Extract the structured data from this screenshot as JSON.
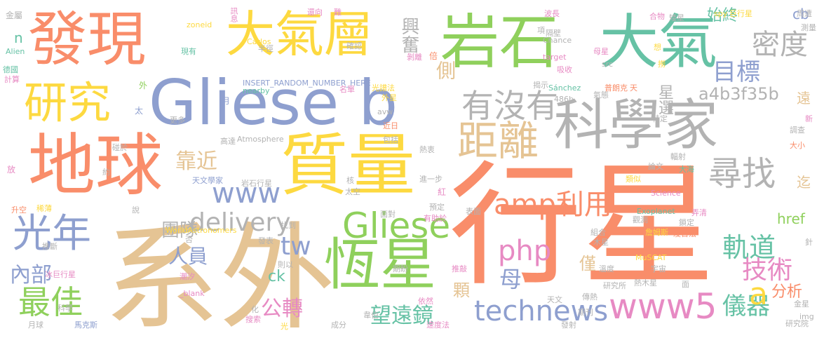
{
  "palette": {
    "orange": "#f98d6a",
    "blue": "#8e9fcf",
    "green": "#8fd05c",
    "yellow": "#fdd940",
    "gray": "#b3b3b3",
    "tan": "#e5c494",
    "teal": "#66c2a5",
    "pink": "#e78ac3"
  },
  "words": [
    {
      "text": "行星",
      "color": "orange"
    },
    {
      "text": "系外",
      "color": "tan"
    },
    {
      "text": "Gliese b",
      "color": "blue"
    },
    {
      "text": "科學家",
      "color": "gray"
    },
    {
      "text": "岩石",
      "color": "green"
    },
    {
      "text": "大氣",
      "color": "teal"
    },
    {
      "text": "發現",
      "color": "orange"
    },
    {
      "text": "大氣層",
      "color": "yellow"
    },
    {
      "text": "質量",
      "color": "yellow"
    },
    {
      "text": "地球",
      "color": "orange"
    },
    {
      "text": "恆星",
      "color": "green"
    },
    {
      "text": "研究",
      "color": "yellow"
    },
    {
      "text": "距離",
      "color": "tan"
    },
    {
      "text": "Gliese",
      "color": "green"
    },
    {
      "text": "www5",
      "color": "pink"
    },
    {
      "text": "光年",
      "color": "blue"
    },
    {
      "text": "technews",
      "color": "blue"
    },
    {
      "text": "尋找",
      "color": "gray"
    },
    {
      "text": "有沒有",
      "color": "gray"
    },
    {
      "text": "最佳",
      "color": "green"
    },
    {
      "text": "密度",
      "color": "gray"
    },
    {
      "text": "目標",
      "color": "blue"
    },
    {
      "text": "www",
      "color": "blue"
    },
    {
      "text": "delivery",
      "color": "gray"
    },
    {
      "text": "amp利用",
      "color": "orange"
    },
    {
      "text": "php",
      "color": "pink"
    },
    {
      "text": "靠近",
      "color": "tan"
    },
    {
      "text": "團隊",
      "color": "gray"
    },
    {
      "text": "軌道",
      "color": "teal"
    },
    {
      "text": "技術",
      "color": "pink"
    },
    {
      "text": "興奮",
      "color": "gray"
    },
    {
      "text": "始終",
      "color": "teal"
    },
    {
      "text": "a4b3f35b",
      "color": "gray"
    },
    {
      "text": "星選",
      "color": "gray"
    },
    {
      "text": "側",
      "color": "tan"
    },
    {
      "text": "tw",
      "color": "blue"
    },
    {
      "text": "人員",
      "color": "blue"
    },
    {
      "text": "內部",
      "color": "blue"
    },
    {
      "text": "公轉",
      "color": "pink"
    },
    {
      "text": "母",
      "color": "blue"
    },
    {
      "text": "望遠鏡",
      "color": "teal"
    },
    {
      "text": "儀器",
      "color": "teal"
    },
    {
      "text": "分析",
      "color": "orange"
    },
    {
      "text": "a",
      "color": "yellow"
    },
    {
      "text": "cb",
      "color": "blue"
    },
    {
      "text": "ck",
      "color": "teal"
    },
    {
      "text": "href",
      "color": "green"
    },
    {
      "text": "僅",
      "color": "tan"
    },
    {
      "text": "顆",
      "color": "tan"
    },
    {
      "text": "遠",
      "color": "tan"
    },
    {
      "text": "迄",
      "color": "tan"
    },
    {
      "text": "n",
      "color": "teal"
    },
    {
      "text": "金屬",
      "color": "gray"
    },
    {
      "text": "Alien",
      "color": "teal"
    },
    {
      "text": "德國",
      "color": "teal"
    },
    {
      "text": "計算",
      "color": "pink"
    },
    {
      "text": "訊息",
      "color": "pink"
    },
    {
      "text": "半徑",
      "color": "gray"
    },
    {
      "text": "zoneid",
      "color": "yellow"
    },
    {
      "text": "現有",
      "color": "teal"
    },
    {
      "text": "Carlos",
      "color": "yellow"
    },
    {
      "text": "確認",
      "color": "gray"
    },
    {
      "text": "INSERT_RANDOM_NUMBER_HERE",
      "color": "blue"
    },
    {
      "text": "nearby",
      "color": "teal"
    },
    {
      "text": "外",
      "color": "green"
    },
    {
      "text": "太",
      "color": "blue"
    },
    {
      "text": "月",
      "color": "blue"
    },
    {
      "text": "更多",
      "color": "gray"
    },
    {
      "text": "碰於",
      "color": "gray"
    },
    {
      "text": "Atmosphere",
      "color": "gray"
    },
    {
      "text": "高達",
      "color": "gray"
    },
    {
      "text": "約",
      "color": "gray"
    },
    {
      "text": "放",
      "color": "pink"
    },
    {
      "text": "天文學家",
      "color": "blue"
    },
    {
      "text": "岩石行星",
      "color": "gray"
    },
    {
      "text": "升空",
      "color": "orange"
    },
    {
      "text": "稀薄",
      "color": "yellow"
    },
    {
      "text": "WorldAstronomers",
      "color": "yellow"
    },
    {
      "text": "找到",
      "color": "gray"
    },
    {
      "text": "否",
      "color": "gray"
    },
    {
      "text": "發表",
      "color": "gray"
    },
    {
      "text": "推斷",
      "color": "gray"
    },
    {
      "text": "冰巨行星",
      "color": "pink"
    },
    {
      "text": "潮汐",
      "color": "pink"
    },
    {
      "text": "_blank",
      "color": "pink"
    },
    {
      "text": "科學",
      "color": "gray"
    },
    {
      "text": "月球",
      "color": "gray"
    },
    {
      "text": "馬克斯",
      "color": "blue"
    },
    {
      "text": "搜索",
      "color": "pink"
    },
    {
      "text": "光",
      "color": "yellow"
    },
    {
      "text": "還向",
      "color": "pink"
    },
    {
      "text": "難",
      "color": "pink"
    },
    {
      "text": "剝離",
      "color": "pink"
    },
    {
      "text": "倍",
      "color": "orange"
    },
    {
      "text": "名單",
      "color": "pink"
    },
    {
      "text": "光譜法",
      "color": "yellow"
    },
    {
      "text": "外星",
      "color": "yellow"
    },
    {
      "text": "avw",
      "color": "gray"
    },
    {
      "text": "近日",
      "color": "orange"
    },
    {
      "text": "包括",
      "color": "gray"
    },
    {
      "text": "熱衷",
      "color": "gray"
    },
    {
      "text": "進一步",
      "color": "gray"
    },
    {
      "text": "紅",
      "color": "pink"
    },
    {
      "text": "太空",
      "color": "gray"
    },
    {
      "text": "核",
      "color": "gray"
    },
    {
      "text": "預定",
      "color": "gray"
    },
    {
      "text": "面對",
      "color": "gray"
    },
    {
      "text": "表面",
      "color": "gray"
    },
    {
      "text": "有助於",
      "color": "pink"
    },
    {
      "text": "期盼",
      "color": "gray"
    },
    {
      "text": "推敲",
      "color": "pink"
    },
    {
      "text": "依然",
      "color": "pink"
    },
    {
      "text": "成分",
      "color": "gray"
    },
    {
      "text": "韋伯",
      "color": "gray"
    },
    {
      "text": "速度法",
      "color": "pink"
    },
    {
      "text": "揭示",
      "color": "gray"
    },
    {
      "text": "486b",
      "color": "gray"
    },
    {
      "text": "target",
      "color": "pink"
    },
    {
      "text": "吸收",
      "color": "pink"
    },
    {
      "text": "Chance",
      "color": "gray"
    },
    {
      "text": "項",
      "color": "gray"
    },
    {
      "text": "隔壁",
      "color": "gray"
    },
    {
      "text": "波長",
      "color": "pink"
    },
    {
      "text": "合物",
      "color": "pink"
    },
    {
      "text": "Sánchez",
      "color": "teal"
    },
    {
      "text": "氣態",
      "color": "gray"
    },
    {
      "text": "src",
      "color": "gray"
    },
    {
      "text": "母星",
      "color": "pink"
    },
    {
      "text": "想",
      "color": "yellow"
    },
    {
      "text": "撈",
      "color": "yellow"
    },
    {
      "text": "普朗克",
      "color": "orange"
    },
    {
      "text": "天",
      "color": "orange"
    },
    {
      "text": "矮星",
      "color": "gray"
    },
    {
      "text": "spy",
      "color": "yellow"
    },
    {
      "text": "巨行星",
      "color": "yellow"
    },
    {
      "text": "周遭",
      "color": "gray"
    },
    {
      "text": "測量",
      "color": "gray"
    },
    {
      "text": "新",
      "color": "pink"
    },
    {
      "text": "調查",
      "color": "gray"
    },
    {
      "text": "大小",
      "color": "orange"
    },
    {
      "text": "特定",
      "color": "gray"
    },
    {
      "text": "論文",
      "color": "gray"
    },
    {
      "text": "輻射",
      "color": "gray"
    },
    {
      "text": "大海",
      "color": "teal"
    },
    {
      "text": "類似",
      "color": "yellow"
    },
    {
      "text": "Science",
      "color": "pink"
    },
    {
      "text": "Exoplanet",
      "color": "teal"
    },
    {
      "text": "弄清",
      "color": "pink"
    },
    {
      "text": "觀測",
      "color": "gray"
    },
    {
      "text": "鎖定",
      "color": "gray"
    },
    {
      "text": "詹姆斯",
      "color": "yellow"
    },
    {
      "text": "凌日法",
      "color": "orange"
    },
    {
      "text": "組合",
      "color": "gray"
    },
    {
      "text": "木星",
      "color": "gray"
    },
    {
      "text": "針",
      "color": "gray"
    },
    {
      "text": "MuSCAT",
      "color": "yellow"
    },
    {
      "text": "溫度",
      "color": "gray"
    },
    {
      "text": "宇宙",
      "color": "gray"
    },
    {
      "text": "熱木星",
      "color": "gray"
    },
    {
      "text": "面",
      "color": "gray"
    },
    {
      "text": "研究所",
      "color": "gray"
    },
    {
      "text": "傳熱",
      "color": "gray"
    },
    {
      "text": "天文",
      "color": "gray"
    },
    {
      "text": "期刊",
      "color": "gray"
    },
    {
      "text": "發射",
      "color": "gray"
    },
    {
      "text": "img",
      "color": "gray"
    },
    {
      "text": "金星",
      "color": "gray"
    },
    {
      "text": "研究院",
      "color": "gray"
    },
    {
      "text": "化",
      "color": "gray"
    },
    {
      "text": "則以",
      "color": "gray"
    },
    {
      "text": "說",
      "color": "gray"
    }
  ]
}
